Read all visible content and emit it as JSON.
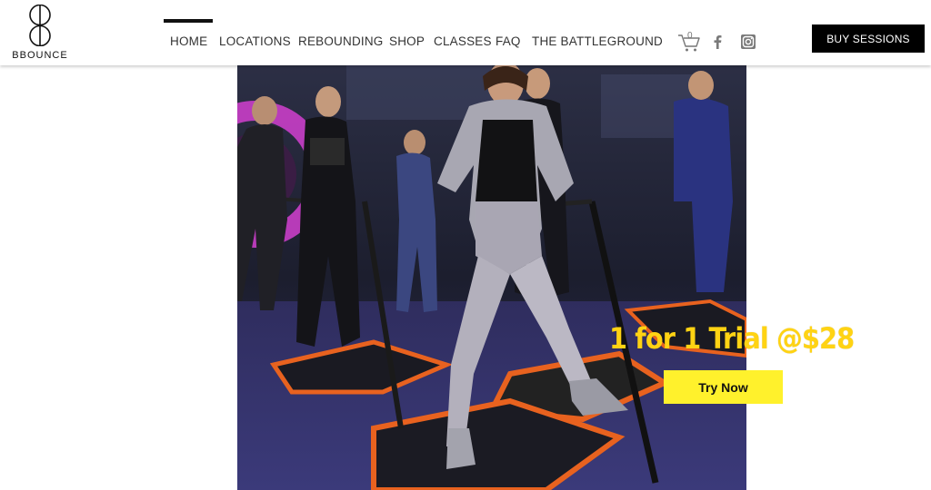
{
  "brand": {
    "name": "BBOUNCE"
  },
  "nav": {
    "items": [
      {
        "label": "HOME",
        "active": true
      },
      {
        "label": "LOCATIONS"
      },
      {
        "label": "REBOUNDING"
      },
      {
        "label": "SHOP"
      },
      {
        "label": "CLASSES"
      },
      {
        "label": "FAQ"
      },
      {
        "label": "THE BATTLEGROUND"
      }
    ]
  },
  "header_actions": {
    "cart_count": "0",
    "cart_icon": "shopping-cart-icon",
    "social_icons": [
      "facebook-icon",
      "instagram-icon"
    ],
    "buy_label": "BUY SESSIONS"
  },
  "hero": {
    "promo_text": "1 for 1 Trial @$28",
    "cta_label": "Try Now"
  },
  "colors": {
    "promo_yellow": "#ffd313",
    "cta_yellow": "#fff12c",
    "buy_button_bg": "#000000",
    "trampoline_accent": "#e8621f",
    "neon_ring": "#d23fd0"
  }
}
